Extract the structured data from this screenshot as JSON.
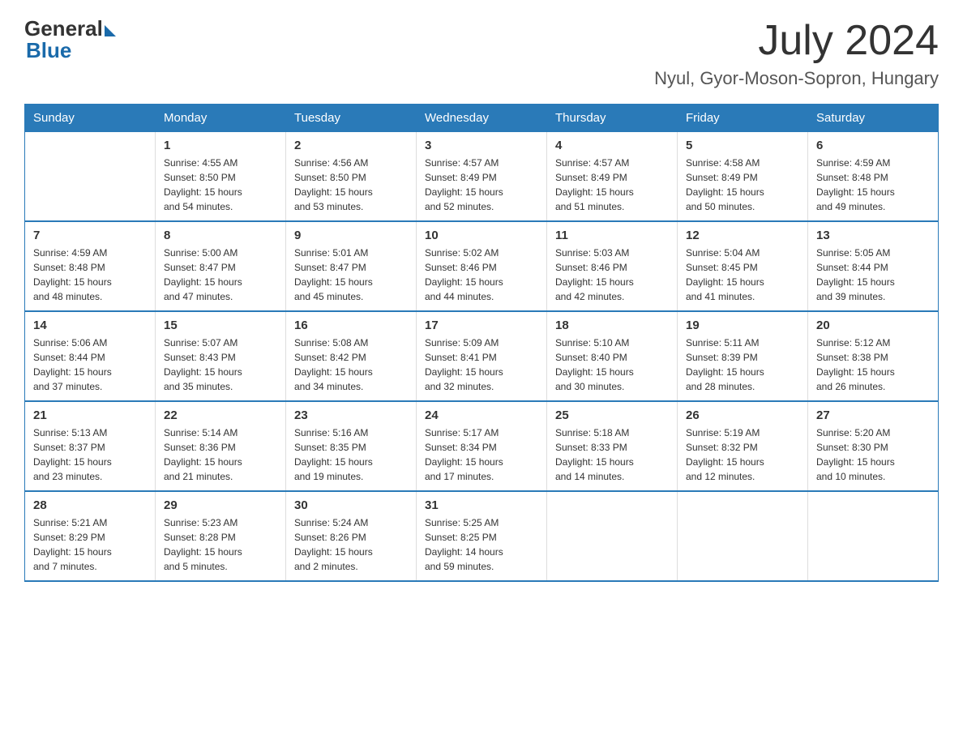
{
  "logo": {
    "general": "General",
    "blue": "Blue"
  },
  "header": {
    "month_year": "July 2024",
    "location": "Nyul, Gyor-Moson-Sopron, Hungary"
  },
  "days_of_week": [
    "Sunday",
    "Monday",
    "Tuesday",
    "Wednesday",
    "Thursday",
    "Friday",
    "Saturday"
  ],
  "weeks": [
    [
      {
        "day": "",
        "info": ""
      },
      {
        "day": "1",
        "info": "Sunrise: 4:55 AM\nSunset: 8:50 PM\nDaylight: 15 hours\nand 54 minutes."
      },
      {
        "day": "2",
        "info": "Sunrise: 4:56 AM\nSunset: 8:50 PM\nDaylight: 15 hours\nand 53 minutes."
      },
      {
        "day": "3",
        "info": "Sunrise: 4:57 AM\nSunset: 8:49 PM\nDaylight: 15 hours\nand 52 minutes."
      },
      {
        "day": "4",
        "info": "Sunrise: 4:57 AM\nSunset: 8:49 PM\nDaylight: 15 hours\nand 51 minutes."
      },
      {
        "day": "5",
        "info": "Sunrise: 4:58 AM\nSunset: 8:49 PM\nDaylight: 15 hours\nand 50 minutes."
      },
      {
        "day": "6",
        "info": "Sunrise: 4:59 AM\nSunset: 8:48 PM\nDaylight: 15 hours\nand 49 minutes."
      }
    ],
    [
      {
        "day": "7",
        "info": "Sunrise: 4:59 AM\nSunset: 8:48 PM\nDaylight: 15 hours\nand 48 minutes."
      },
      {
        "day": "8",
        "info": "Sunrise: 5:00 AM\nSunset: 8:47 PM\nDaylight: 15 hours\nand 47 minutes."
      },
      {
        "day": "9",
        "info": "Sunrise: 5:01 AM\nSunset: 8:47 PM\nDaylight: 15 hours\nand 45 minutes."
      },
      {
        "day": "10",
        "info": "Sunrise: 5:02 AM\nSunset: 8:46 PM\nDaylight: 15 hours\nand 44 minutes."
      },
      {
        "day": "11",
        "info": "Sunrise: 5:03 AM\nSunset: 8:46 PM\nDaylight: 15 hours\nand 42 minutes."
      },
      {
        "day": "12",
        "info": "Sunrise: 5:04 AM\nSunset: 8:45 PM\nDaylight: 15 hours\nand 41 minutes."
      },
      {
        "day": "13",
        "info": "Sunrise: 5:05 AM\nSunset: 8:44 PM\nDaylight: 15 hours\nand 39 minutes."
      }
    ],
    [
      {
        "day": "14",
        "info": "Sunrise: 5:06 AM\nSunset: 8:44 PM\nDaylight: 15 hours\nand 37 minutes."
      },
      {
        "day": "15",
        "info": "Sunrise: 5:07 AM\nSunset: 8:43 PM\nDaylight: 15 hours\nand 35 minutes."
      },
      {
        "day": "16",
        "info": "Sunrise: 5:08 AM\nSunset: 8:42 PM\nDaylight: 15 hours\nand 34 minutes."
      },
      {
        "day": "17",
        "info": "Sunrise: 5:09 AM\nSunset: 8:41 PM\nDaylight: 15 hours\nand 32 minutes."
      },
      {
        "day": "18",
        "info": "Sunrise: 5:10 AM\nSunset: 8:40 PM\nDaylight: 15 hours\nand 30 minutes."
      },
      {
        "day": "19",
        "info": "Sunrise: 5:11 AM\nSunset: 8:39 PM\nDaylight: 15 hours\nand 28 minutes."
      },
      {
        "day": "20",
        "info": "Sunrise: 5:12 AM\nSunset: 8:38 PM\nDaylight: 15 hours\nand 26 minutes."
      }
    ],
    [
      {
        "day": "21",
        "info": "Sunrise: 5:13 AM\nSunset: 8:37 PM\nDaylight: 15 hours\nand 23 minutes."
      },
      {
        "day": "22",
        "info": "Sunrise: 5:14 AM\nSunset: 8:36 PM\nDaylight: 15 hours\nand 21 minutes."
      },
      {
        "day": "23",
        "info": "Sunrise: 5:16 AM\nSunset: 8:35 PM\nDaylight: 15 hours\nand 19 minutes."
      },
      {
        "day": "24",
        "info": "Sunrise: 5:17 AM\nSunset: 8:34 PM\nDaylight: 15 hours\nand 17 minutes."
      },
      {
        "day": "25",
        "info": "Sunrise: 5:18 AM\nSunset: 8:33 PM\nDaylight: 15 hours\nand 14 minutes."
      },
      {
        "day": "26",
        "info": "Sunrise: 5:19 AM\nSunset: 8:32 PM\nDaylight: 15 hours\nand 12 minutes."
      },
      {
        "day": "27",
        "info": "Sunrise: 5:20 AM\nSunset: 8:30 PM\nDaylight: 15 hours\nand 10 minutes."
      }
    ],
    [
      {
        "day": "28",
        "info": "Sunrise: 5:21 AM\nSunset: 8:29 PM\nDaylight: 15 hours\nand 7 minutes."
      },
      {
        "day": "29",
        "info": "Sunrise: 5:23 AM\nSunset: 8:28 PM\nDaylight: 15 hours\nand 5 minutes."
      },
      {
        "day": "30",
        "info": "Sunrise: 5:24 AM\nSunset: 8:26 PM\nDaylight: 15 hours\nand 2 minutes."
      },
      {
        "day": "31",
        "info": "Sunrise: 5:25 AM\nSunset: 8:25 PM\nDaylight: 14 hours\nand 59 minutes."
      },
      {
        "day": "",
        "info": ""
      },
      {
        "day": "",
        "info": ""
      },
      {
        "day": "",
        "info": ""
      }
    ]
  ]
}
